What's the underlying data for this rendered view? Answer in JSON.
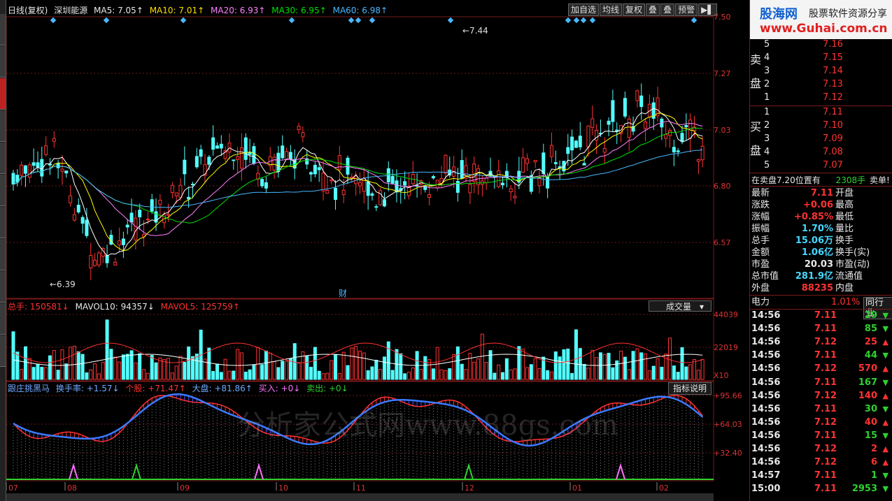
{
  "header": {
    "period_label": "日线(复权)",
    "stock_name": "深圳能源",
    "ma5": "MA5: 7.05↑",
    "ma10": "MA10: 7.01↑",
    "ma20": "MA20: 6.93↑",
    "ma30": "MA30: 6.95↑",
    "ma60": "MA60: 6.98↑"
  },
  "toolbar": {
    "add_fav": "加自选",
    "avg_line": "均线",
    "restore": "复权",
    "overlay": "叠",
    "stack": "叠",
    "warn": "预警",
    "icon": "▶▌"
  },
  "price_axis": [
    "7.50",
    "7.27",
    "7.03",
    "6.80",
    "6.57"
  ],
  "annotations": {
    "high": "7.44",
    "low": "6.39",
    "fin": "财"
  },
  "volume_header": {
    "total": "总手: 150581↓",
    "mavol10": "MAVOL10: 94357↓",
    "mavol5": "MAVOL5: 125759↑",
    "dropdown": "成交量"
  },
  "volume_axis": [
    "44039",
    "22019",
    "X10"
  ],
  "indicator_header": {
    "name": "跟庄挑黑马",
    "turnover": "换手率: +1.57↓",
    "stock": "个股: +71.47↑",
    "market": "大盘: +81.86↑",
    "buy": "买入: +0↓",
    "sell": "卖出: +0↓",
    "explain": "指标说明"
  },
  "indicator_axis": [
    "+95.66",
    "+64.03",
    "+32.40"
  ],
  "watermark": "分析家公式网www.88gs.com",
  "months": [
    "07",
    "08",
    "09",
    "10",
    "11",
    "12",
    "01",
    "02"
  ],
  "brand": {
    "logo": "股海网",
    "slogan": "股票软件资源分享",
    "url": "www.Guhai.com.cn"
  },
  "order_book": {
    "sell_label": [
      "卖",
      "盘"
    ],
    "buy_label": [
      "买",
      "盘"
    ],
    "sells": [
      {
        "lvl": "5",
        "price": "7.16"
      },
      {
        "lvl": "4",
        "price": "7.15"
      },
      {
        "lvl": "3",
        "price": "7.14"
      },
      {
        "lvl": "2",
        "price": "7.13"
      },
      {
        "lvl": "1",
        "price": "7.12"
      }
    ],
    "buys": [
      {
        "lvl": "1",
        "price": "7.11"
      },
      {
        "lvl": "2",
        "price": "7.10"
      },
      {
        "lvl": "3",
        "price": "7.09"
      },
      {
        "lvl": "4",
        "price": "7.08"
      },
      {
        "lvl": "5",
        "price": "7.07"
      }
    ],
    "note_left": "在卖盘7.20位置有",
    "note_qty": "2308手",
    "note_right": "卖单! 查"
  },
  "quote": [
    {
      "k": "最新",
      "v": "7.11",
      "c": "red",
      "k2": "开盘"
    },
    {
      "k": "涨跌",
      "v": "+0.06",
      "c": "red",
      "k2": "最高"
    },
    {
      "k": "涨幅",
      "v": "+0.85%",
      "c": "red",
      "k2": "最低"
    },
    {
      "k": "振幅",
      "v": "1.70%",
      "c": "cyan",
      "k2": "量比"
    },
    {
      "k": "总手",
      "v": "15.06万",
      "c": "cyan",
      "k2": "换手"
    },
    {
      "k": "金额",
      "v": "1.06亿",
      "c": "cyan",
      "k2": "换手(实)"
    },
    {
      "k": "市盈",
      "v": "20.03",
      "c": "white",
      "k2": "市盈(动)"
    },
    {
      "k": "总市值",
      "v": "281.9亿",
      "c": "cyan",
      "k2": "流通值"
    },
    {
      "k": "外盘",
      "v": "88235",
      "c": "red",
      "k2": "内盘"
    }
  ],
  "sector": {
    "name": "电力",
    "pct": "1.01%",
    "btn": "同行业"
  },
  "ticks": [
    {
      "t": "14:56",
      "p": "7.11",
      "v": "29",
      "d": "down"
    },
    {
      "t": "14:56",
      "p": "7.11",
      "v": "85",
      "d": "down"
    },
    {
      "t": "14:56",
      "p": "7.12",
      "v": "25",
      "d": "up"
    },
    {
      "t": "14:56",
      "p": "7.11",
      "v": "44",
      "d": "down"
    },
    {
      "t": "14:56",
      "p": "7.12",
      "v": "570",
      "d": "up"
    },
    {
      "t": "14:56",
      "p": "7.11",
      "v": "167",
      "d": "down"
    },
    {
      "t": "14:56",
      "p": "7.12",
      "v": "140",
      "d": "up"
    },
    {
      "t": "14:56",
      "p": "7.11",
      "v": "30",
      "d": "down"
    },
    {
      "t": "14:56",
      "p": "7.12",
      "v": "40",
      "d": "up"
    },
    {
      "t": "14:56",
      "p": "7.11",
      "v": "15",
      "d": "down"
    },
    {
      "t": "14:56",
      "p": "7.12",
      "v": "2",
      "d": "up"
    },
    {
      "t": "14:56",
      "p": "7.12",
      "v": "6",
      "d": "up"
    },
    {
      "t": "14:57",
      "p": "7.11",
      "v": "1",
      "d": "down"
    },
    {
      "t": "15:00",
      "p": "7.11",
      "v": "2953",
      "d": "down"
    }
  ],
  "colors": {
    "up": "#ff3232",
    "down": "#54ffff",
    "ma5": "#ffffff",
    "ma10": "#ffff00",
    "ma20": "#ff80ff",
    "ma30": "#00e000",
    "ma60": "#48b8ff"
  }
}
